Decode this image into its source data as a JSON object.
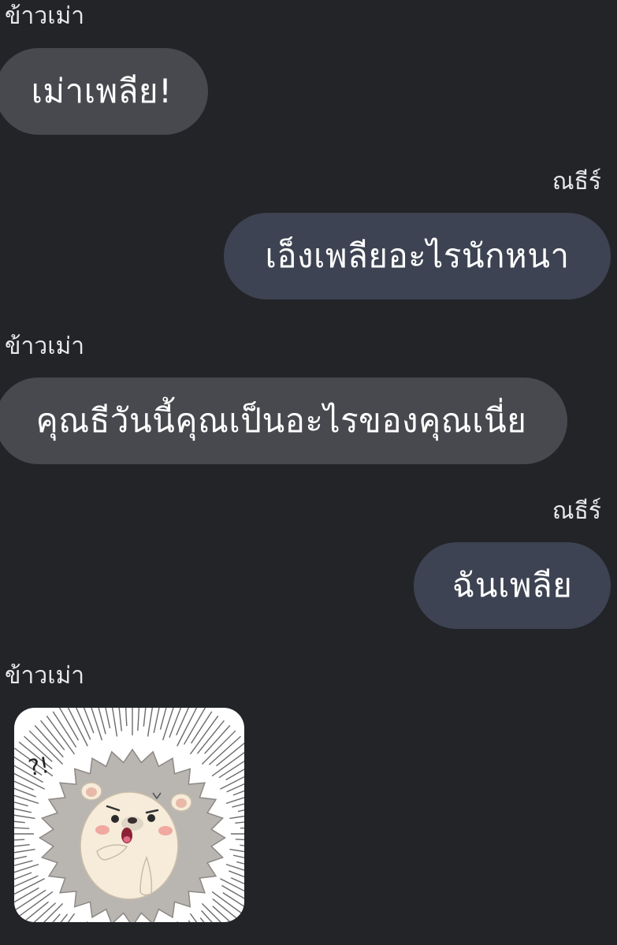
{
  "messages": [
    {
      "sender": "ข้าวเม่า",
      "side": "left",
      "text": "เม่าเพลีย!"
    },
    {
      "sender": "ณธีร์",
      "side": "right",
      "text": "เอ็งเพลียอะไรนักหนา"
    },
    {
      "sender": "ข้าวเม่า",
      "side": "left",
      "text": "คุณธีวันนี้คุณเป็นอะไรของคุณเนี่ย"
    },
    {
      "sender": "ณธีร์",
      "side": "right",
      "text": "ฉันเพลีย"
    },
    {
      "sender": "ข้าวเม่า",
      "side": "left",
      "sticker": "hedgehog-surprised",
      "sticker_text": "?!"
    }
  ],
  "colors": {
    "background": "#232428",
    "incoming_bubble": "#48494e",
    "outgoing_bubble": "#3d4352",
    "text": "#ffffff"
  }
}
